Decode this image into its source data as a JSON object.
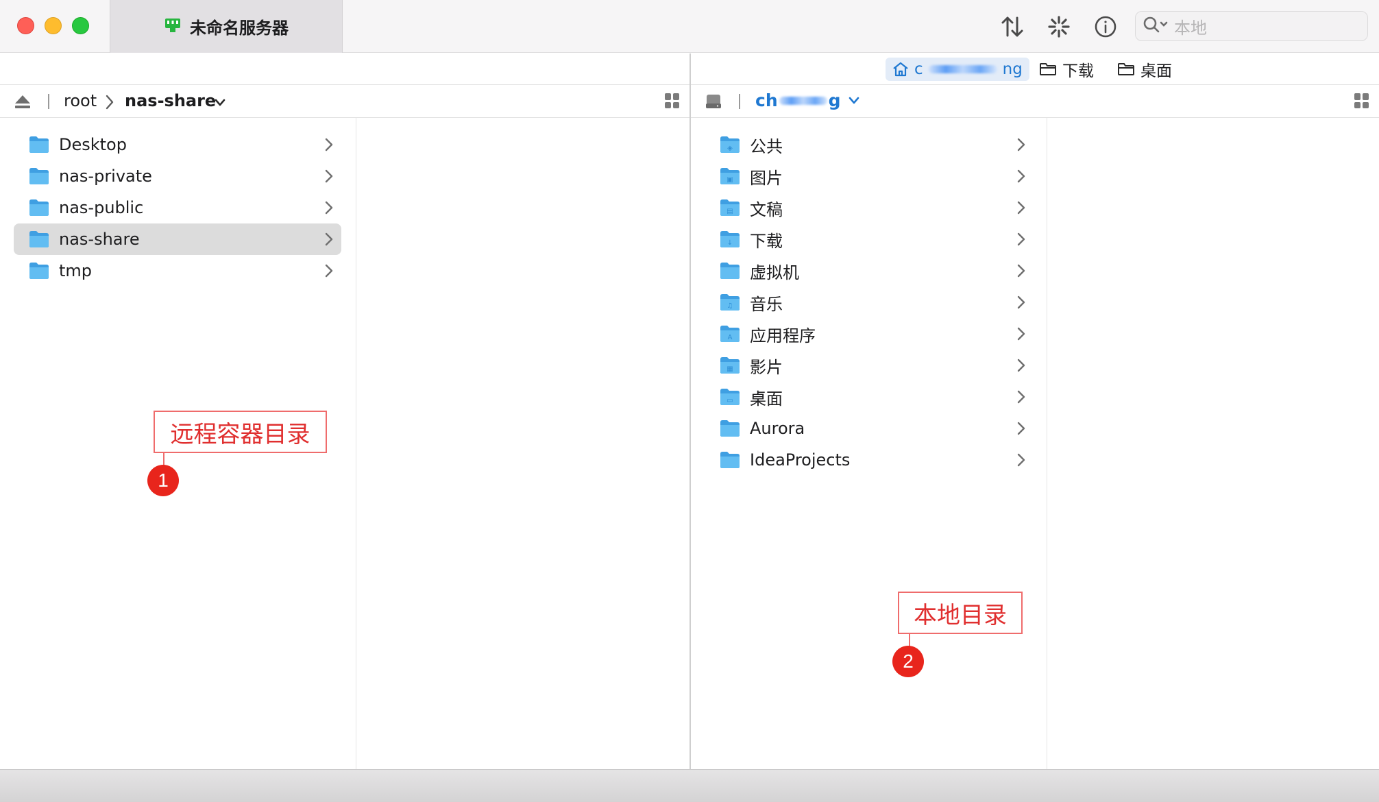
{
  "window": {
    "tab_title": "未命名服务器",
    "search_placeholder": "本地",
    "toolbar_icons": [
      "transfer-arrows-icon",
      "activity-spinner-icon",
      "info-icon",
      "search-icon"
    ]
  },
  "remote": {
    "breadcrumb": [
      "root",
      "nas-share"
    ],
    "items": [
      {
        "label": "Desktop",
        "selected": false
      },
      {
        "label": "nas-private",
        "selected": false
      },
      {
        "label": "nas-public",
        "selected": false
      },
      {
        "label": "nas-share",
        "selected": true
      },
      {
        "label": "tmp",
        "selected": false
      }
    ]
  },
  "local": {
    "favorites": [
      {
        "prefix": "c",
        "suffix": "ng",
        "icon": "home-icon",
        "active": true
      },
      {
        "label": "下载",
        "icon": "folder-icon",
        "active": false
      },
      {
        "label": "桌面",
        "icon": "folder-icon",
        "active": false
      }
    ],
    "path_prefix": "ch",
    "path_suffix": "g",
    "items": [
      {
        "label": "公共",
        "glyph": "◈"
      },
      {
        "label": "图片",
        "glyph": "▣"
      },
      {
        "label": "文稿",
        "glyph": "▤"
      },
      {
        "label": "下载",
        "glyph": "↓"
      },
      {
        "label": "虚拟机",
        "glyph": ""
      },
      {
        "label": "音乐",
        "glyph": "♫"
      },
      {
        "label": "应用程序",
        "glyph": "A"
      },
      {
        "label": "影片",
        "glyph": "▦"
      },
      {
        "label": "桌面",
        "glyph": "▭"
      },
      {
        "label": "Aurora",
        "glyph": ""
      },
      {
        "label": "IdeaProjects",
        "glyph": ""
      }
    ]
  },
  "annotations": [
    {
      "label": "远程容器目录",
      "number": "1"
    },
    {
      "label": "本地目录",
      "number": "2"
    }
  ],
  "colors": {
    "accent": "#1f78d1",
    "annotation": "#e8251c",
    "folder": "#5ab4ee"
  }
}
